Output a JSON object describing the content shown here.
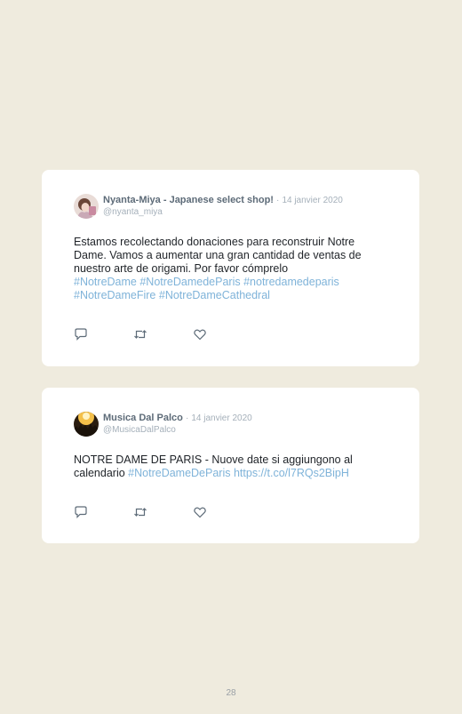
{
  "tweets": [
    {
      "author_name": "Nyanta-Miya - Japanese select shop!",
      "separator": "·",
      "date": "14 janvier 2020",
      "handle": "@nyanta_miya",
      "text_plain": "Estamos recolectando donaciones para reconstruir Notre Dame. Vamos a aumentar una gran cantidad de ventas de nuestro arte de origami. Por favor cómprelo",
      "hashtags": [
        "#NotreDame",
        "#NotreDamedeParis",
        "#notredamedeparis",
        "#NotreDameFire",
        "#NotreDameCathedral"
      ],
      "avatar_icon": "avatar-photo-icon"
    },
    {
      "author_name": "Musica Dal Palco",
      "separator": "·",
      "date": "14 janvier 2020",
      "handle": "@MusicaDalPalco",
      "text_plain": "NOTRE DAME DE PARIS - Nuove date si aggiungono al calendario",
      "hashtag": "#NotreDameDeParis",
      "link": "https://t.co/l7RQs2BipH",
      "avatar_icon": "avatar-concert-icon"
    }
  ],
  "action_icons": [
    "reply-icon",
    "retweet-icon",
    "like-icon"
  ],
  "colors": {
    "background": "#efebde",
    "card": "#ffffff",
    "link": "#7fb3d9",
    "name": "#5d6b78",
    "meta": "#a5b0ba"
  },
  "page_number": "28"
}
